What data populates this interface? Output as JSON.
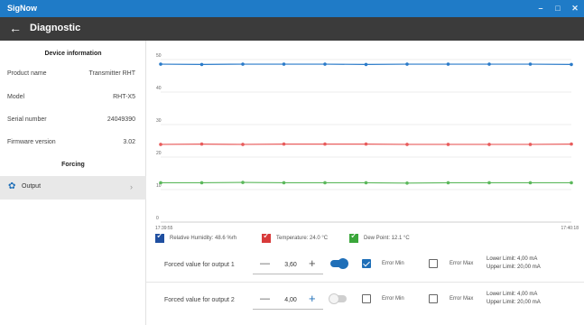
{
  "window": {
    "title": "SigNow",
    "minimize_glyph": "–",
    "maximize_glyph": "□",
    "close_glyph": "✕"
  },
  "header": {
    "back_glyph": "←",
    "title": "Diagnostic"
  },
  "sidebar": {
    "device_info_title": "Device information",
    "rows": [
      {
        "label": "Product name",
        "value": "Transmitter RHT"
      },
      {
        "label": "Model",
        "value": "RHT-X5"
      },
      {
        "label": "Serial number",
        "value": "24049390"
      },
      {
        "label": "Firmware version",
        "value": "3.02"
      }
    ],
    "forcing_title": "Forcing",
    "nav": {
      "label": "Output",
      "icon": "gear-icon",
      "chevron": "›"
    }
  },
  "chart_data": {
    "type": "line",
    "x_tick_labels": [
      "17:39:55",
      "17:40:18"
    ],
    "y_ticks": [
      0,
      10,
      20,
      30,
      40,
      50
    ],
    "ylim": [
      0,
      50
    ],
    "grid": true,
    "x": [
      0,
      1,
      2,
      3,
      4,
      5,
      6,
      7,
      8,
      9,
      10
    ],
    "series": [
      {
        "name": "Relative Humidity: 48.6 %rh",
        "color": "#2b7bc9",
        "values": [
          48.6,
          48.5,
          48.6,
          48.6,
          48.6,
          48.5,
          48.6,
          48.6,
          48.6,
          48.6,
          48.5
        ]
      },
      {
        "name": "Temperature: 24.0 °C",
        "color": "#e85c5c",
        "values": [
          23.9,
          24.0,
          23.9,
          24.0,
          24.0,
          24.0,
          23.9,
          23.9,
          23.9,
          23.9,
          24.0
        ]
      },
      {
        "name": "Dew Point: 12.1 °C",
        "color": "#5cb85c",
        "values": [
          12.1,
          12.1,
          12.2,
          12.1,
          12.1,
          12.1,
          12.0,
          12.1,
          12.1,
          12.1,
          12.1
        ]
      }
    ]
  },
  "legend": [
    {
      "label": "Relative Humidity: 48.6 %rh",
      "color": "#1f4fa0"
    },
    {
      "label": "Temperature: 24.0 °C",
      "color": "#d83a3a"
    },
    {
      "label": "Dew Point: 12.1 °C",
      "color": "#3aa63a"
    }
  ],
  "outputs": [
    {
      "label": "Forced value for output 1",
      "minus": "—",
      "value": "3,60",
      "plus": "+",
      "enabled": true,
      "error_min": {
        "label": "Error Min",
        "checked": true
      },
      "error_max": {
        "label": "Error Max",
        "checked": false
      },
      "lower": "Lower Limit: 4,00 mA",
      "upper": "Upper Limit: 20,00 mA"
    },
    {
      "label": "Forced value for output 2",
      "minus": "—",
      "value": "4,00",
      "plus": "+",
      "enabled": false,
      "error_min": {
        "label": "Error Min",
        "checked": false
      },
      "error_max": {
        "label": "Error Max",
        "checked": false
      },
      "lower": "Lower Limit: 4,00 mA",
      "upper": "Upper Limit: 20,00 mA"
    }
  ],
  "colors": {
    "accent": "#1f6fb8",
    "titlebar": "#1f7bc7",
    "header": "#3b3b3b"
  }
}
